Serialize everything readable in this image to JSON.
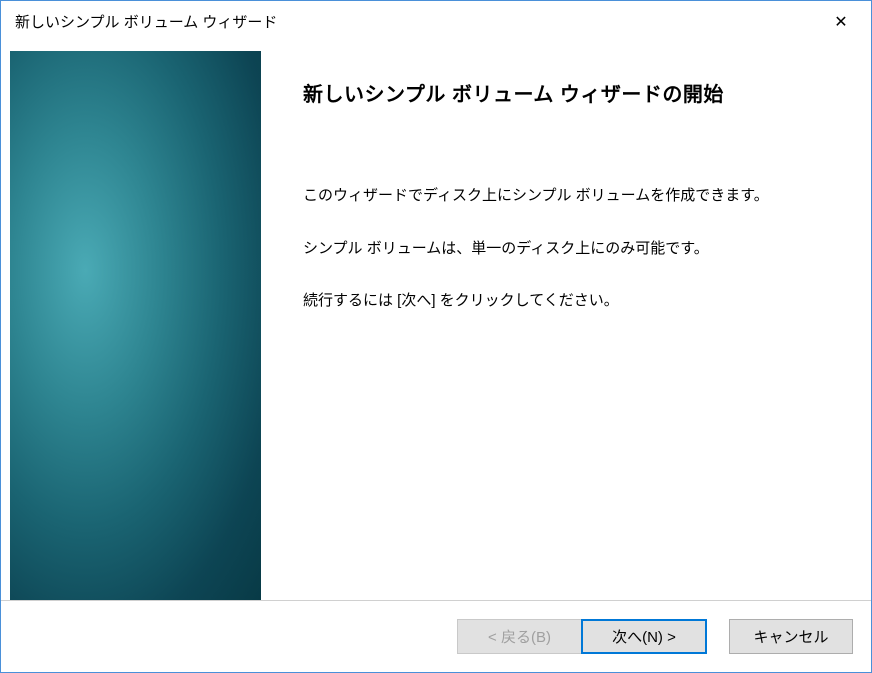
{
  "titlebar": {
    "title": "新しいシンプル ボリューム ウィザード"
  },
  "main": {
    "heading": "新しいシンプル ボリューム ウィザードの開始",
    "line1": "このウィザードでディスク上にシンプル ボリュームを作成できます。",
    "line2": "シンプル ボリュームは、単一のディスク上にのみ可能です。",
    "line3": "続行するには [次へ] をクリックしてください。"
  },
  "footer": {
    "back": "< 戻る(B)",
    "next": "次へ(N) >",
    "cancel": "キャンセル"
  }
}
